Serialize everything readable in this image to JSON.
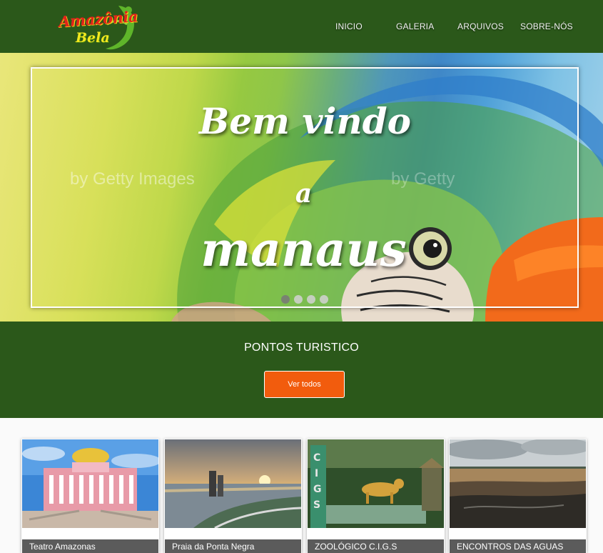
{
  "brand": {
    "line1": "Amazônia",
    "line2": "Bela"
  },
  "nav": [
    "INICIO",
    "GALERIA",
    "ARQUIVOS",
    "SOBRE-NÓS"
  ],
  "hero": {
    "line1": "Bem vindo",
    "line2": "a",
    "line3": "manaus",
    "watermark": "by Getty Images",
    "slides_total": 4,
    "active_slide": 1
  },
  "section": {
    "title": "PONTOS TURISTICO",
    "button": "Ver todos"
  },
  "cards": [
    {
      "title": "Teatro Amazonas"
    },
    {
      "title": "Praia da Ponta Negra"
    },
    {
      "title": "ZOOLÓGICO C.I.G.S"
    },
    {
      "title": "ENCONTROS DAS AGUAS"
    }
  ],
  "colors": {
    "header_green": "#2b581a",
    "accent_orange": "#f25c0d",
    "caption_gray": "#5b5b5b"
  }
}
